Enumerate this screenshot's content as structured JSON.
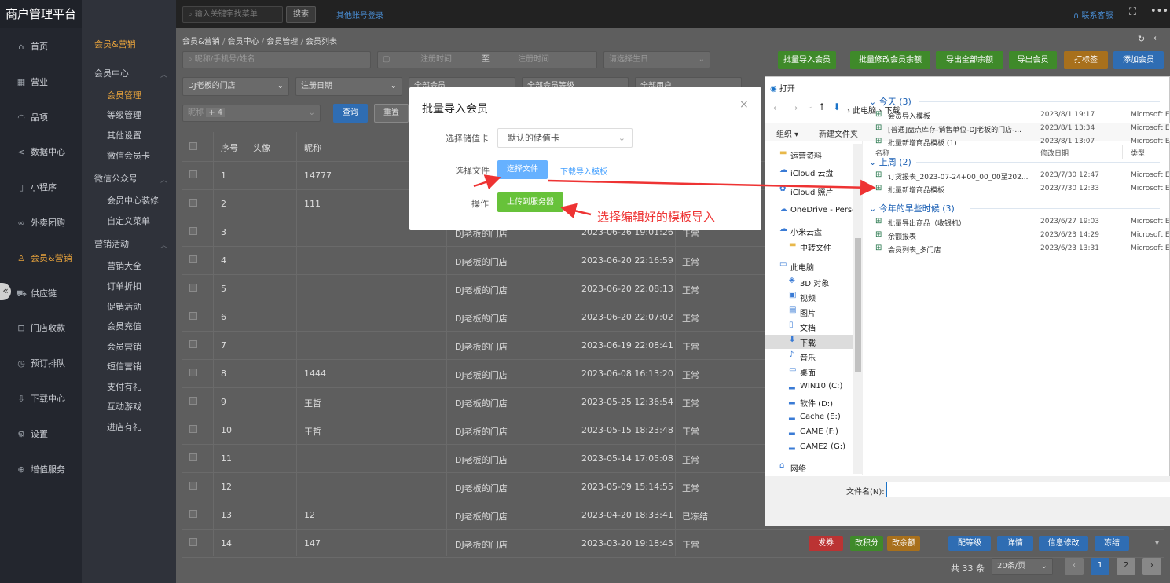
{
  "app": {
    "title": "商户管理平台"
  },
  "topbar": {
    "search_placeholder": "输入关键字找菜单",
    "search_btn": "搜索",
    "other_login": "其他账号登录",
    "service": "联系客服"
  },
  "sidebar": {
    "items": [
      {
        "label": "首页",
        "icon": "home-icon"
      },
      {
        "label": "营业",
        "icon": "calendar-icon"
      },
      {
        "label": "品项",
        "icon": "bag-icon"
      },
      {
        "label": "数据中心",
        "icon": "share-icon"
      },
      {
        "label": "小程序",
        "icon": "phone-icon"
      },
      {
        "label": "外卖团购",
        "icon": "group-icon"
      },
      {
        "label": "会员&营销",
        "icon": "user-icon",
        "active": true
      },
      {
        "label": "供应链",
        "icon": "truck-icon"
      },
      {
        "label": "门店收款",
        "icon": "wallet-icon"
      },
      {
        "label": "预订排队",
        "icon": "clock-icon"
      },
      {
        "label": "下载中心",
        "icon": "download-icon"
      },
      {
        "label": "设置",
        "icon": "gear-icon"
      },
      {
        "label": "增值服务",
        "icon": "plus-icon"
      }
    ]
  },
  "subnav": {
    "header": "会员&营销",
    "groups": [
      {
        "title": "会员中心",
        "items": [
          "会员管理",
          "等级管理",
          "其他设置",
          "微信会员卡"
        ]
      },
      {
        "title": "微信公众号",
        "items": [
          "会员中心装修",
          "自定义菜单"
        ]
      },
      {
        "title": "营销活动",
        "items": [
          "营销大全",
          "订单折扣",
          "促销活动",
          "会员充值",
          "会员营销",
          "短信营销",
          "支付有礼",
          "互动游戏",
          "进店有礼"
        ]
      }
    ]
  },
  "breadcrumb": [
    "会员&营销",
    "会员中心",
    "会员管理",
    "会员列表"
  ],
  "filters": {
    "name_placeholder": "昵称/手机号/姓名",
    "reg_start": "注册时间",
    "to": "至",
    "reg_end": "注册时间",
    "birthday": "请选择生日",
    "store": "DJ老板的门店",
    "date_type": "注册日期",
    "member_all": "全部会员",
    "level_all": "全部会员等级",
    "user_all": "全部用户",
    "field": "昵称",
    "field_extra": "+ 4",
    "query": "查询",
    "reset": "重置"
  },
  "actions": [
    "批量导入会员",
    "批量修改会员余额",
    "导出全部余额",
    "导出会员",
    "打标签",
    "添加会员"
  ],
  "table": {
    "headers": [
      "序号",
      "头像",
      "昵称"
    ],
    "rows": [
      {
        "no": "1",
        "nick": "14777",
        "store": "",
        "time": "",
        "status": ""
      },
      {
        "no": "2",
        "nick": "111",
        "store": "",
        "time": "",
        "status": ""
      },
      {
        "no": "3",
        "nick": "",
        "store": "DJ老板的门店",
        "time": "2023-06-26 19:01:26",
        "status": "正常"
      },
      {
        "no": "4",
        "nick": "",
        "store": "DJ老板的门店",
        "time": "2023-06-20 22:16:59",
        "status": "正常"
      },
      {
        "no": "5",
        "nick": "",
        "store": "DJ老板的门店",
        "time": "2023-06-20 22:08:13",
        "status": "正常"
      },
      {
        "no": "6",
        "nick": "",
        "store": "DJ老板的门店",
        "time": "2023-06-20 22:07:02",
        "status": "正常"
      },
      {
        "no": "7",
        "nick": "",
        "store": "DJ老板的门店",
        "time": "2023-06-19 22:08:41",
        "status": "正常"
      },
      {
        "no": "8",
        "nick": "1444",
        "store": "DJ老板的门店",
        "time": "2023-06-08 16:13:20",
        "status": "正常"
      },
      {
        "no": "9",
        "nick": "王哲",
        "store": "DJ老板的门店",
        "time": "2023-05-25 12:36:54",
        "status": "正常"
      },
      {
        "no": "10",
        "nick": "王哲",
        "store": "DJ老板的门店",
        "time": "2023-05-15 18:23:48",
        "status": "正常"
      },
      {
        "no": "11",
        "nick": "",
        "store": "DJ老板的门店",
        "time": "2023-05-14 17:05:08",
        "status": "正常"
      },
      {
        "no": "12",
        "nick": "",
        "store": "DJ老板的门店",
        "time": "2023-05-09 15:14:55",
        "status": "正常"
      },
      {
        "no": "13",
        "nick": "12",
        "store": "DJ老板的门店",
        "time": "2023-04-20 18:33:41",
        "status": "已冻结"
      },
      {
        "no": "14",
        "nick": "147",
        "store": "DJ老板的门店",
        "time": "2023-03-20 19:18:45",
        "status": "正常"
      }
    ]
  },
  "row_actions": [
    "发券",
    "改积分",
    "改余额",
    "配等级",
    "详情",
    "信息修改",
    "冻结"
  ],
  "pager": {
    "total": "共 33 条",
    "size": "20条/页",
    "p1": "1",
    "p2": "2"
  },
  "dialog": {
    "title": "批量导入会员",
    "card_label": "选择储值卡",
    "card_value": "默认的储值卡",
    "file_label": "选择文件",
    "choose": "选择文件",
    "template": "下载导入模板",
    "op_label": "操作",
    "upload": "上传到服务器",
    "annotation": "选择编辑好的模板导入"
  },
  "filedlg": {
    "title": "打开",
    "path": [
      "此电脑",
      "下载"
    ],
    "organize": "组织 ▾",
    "newfolder": "新建文件夹",
    "nav": [
      "运营资料",
      "iCloud 云盘",
      "iCloud 照片",
      "OneDrive - Perso",
      "小米云盘",
      "中转文件",
      "此电脑",
      "3D 对象",
      "视频",
      "图片",
      "文档",
      "下载",
      "音乐",
      "桌面",
      "WIN10 (C:)",
      "软件 (D:)",
      "Cache (E:)",
      "GAME (F:)",
      "GAME2 (G:)",
      "网络"
    ],
    "cols": [
      "名称",
      "修改日期",
      "类型"
    ],
    "groups": [
      {
        "title": "今天 (3)",
        "files": [
          {
            "name": "会员导入模板",
            "date": "2023/8/1 19:17",
            "type": "Microsoft E"
          },
          {
            "name": "[普通]盘点库存-销售单位-DJ老板的门店-...",
            "date": "2023/8/1 13:34",
            "type": "Microsoft E"
          },
          {
            "name": "批量新增商品模板 (1)",
            "date": "2023/8/1 13:07",
            "type": "Microsoft E"
          }
        ]
      },
      {
        "title": "上周 (2)",
        "files": [
          {
            "name": "订货报表_2023-07-24+00_00_00至202...",
            "date": "2023/7/30 12:47",
            "type": "Microsoft E"
          },
          {
            "name": "批量新增商品模板",
            "date": "2023/7/30 12:33",
            "type": "Microsoft E"
          }
        ]
      },
      {
        "title": "今年的早些时候 (3)",
        "files": [
          {
            "name": "批量导出商品（收银机）",
            "date": "2023/6/27 19:03",
            "type": "Microsoft E"
          },
          {
            "name": "余额报表",
            "date": "2023/6/23 14:29",
            "type": "Microsoft E"
          },
          {
            "name": "会员列表_多门店",
            "date": "2023/6/23 13:31",
            "type": "Microsoft E"
          }
        ]
      }
    ],
    "filename_label": "文件名(N):"
  },
  "colors": {
    "accent": "#e6a23c",
    "green": "#67c23a",
    "blue": "#409eff",
    "red_arrow": "#e33"
  }
}
